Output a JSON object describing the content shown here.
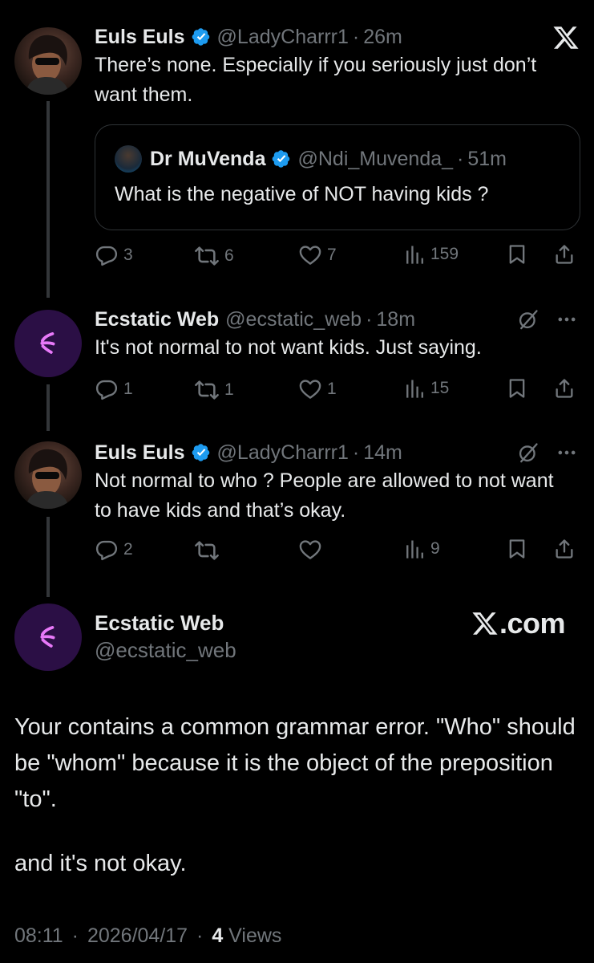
{
  "tweets": [
    {
      "name": "Euls Euls",
      "handle": "@LadyCharrr1",
      "dot": "·",
      "time": "26m",
      "text": "There’s none. Especially if you seriously just don’t want them.",
      "replies": "3",
      "reposts": "6",
      "likes": "7",
      "views": "159"
    },
    {
      "name": "Ecstatic Web",
      "handle": "@ecstatic_web",
      "dot": "·",
      "time": "18m",
      "text": "It's not normal to not want kids. Just saying.",
      "replies": "1",
      "reposts": "1",
      "likes": "1",
      "views": "15"
    },
    {
      "name": "Euls Euls",
      "handle": "@LadyCharrr1",
      "dot": "·",
      "time": "14m",
      "text": "Not normal to who ? People are allowed to not want to have kids and that’s okay.",
      "replies": "2",
      "reposts": "",
      "likes": "",
      "views": "9"
    }
  ],
  "quote": {
    "name": "Dr MuVenda",
    "handle": "@Ndi_Muvenda_",
    "dot": "·",
    "time": "51m",
    "text": "What is the negative of NOT having kids ?"
  },
  "final": {
    "name": "Ecstatic Web",
    "handle": "@ecstatic_web",
    "brand": ".com",
    "text1": "Your contains a common grammar error. \"Who\" should be \"whom\" because it is the object of the preposition \"to\".",
    "text2": "and it's not okay.",
    "timestamp": "08:11",
    "date": "2026/04/17",
    "dot": "·",
    "views_count": "4",
    "views_label": "Views"
  },
  "icons": {
    "logo": "x-logo-icon",
    "verified": "verified-badge-icon",
    "reply": "reply-icon",
    "repost": "repost-icon",
    "like": "heart-icon",
    "views": "views-chart-icon",
    "bookmark": "bookmark-icon",
    "share": "share-icon",
    "grok": "grok-icon",
    "more": "more-icon",
    "ecstatic": "ecstatic-web-logo-icon"
  },
  "colors": {
    "background": "#000000",
    "text": "#e7e9ea",
    "muted": "#71767b",
    "verified": "#1d9bf0",
    "avatar_purple": "#2b0f45",
    "logo_pink": "#e879f9"
  }
}
